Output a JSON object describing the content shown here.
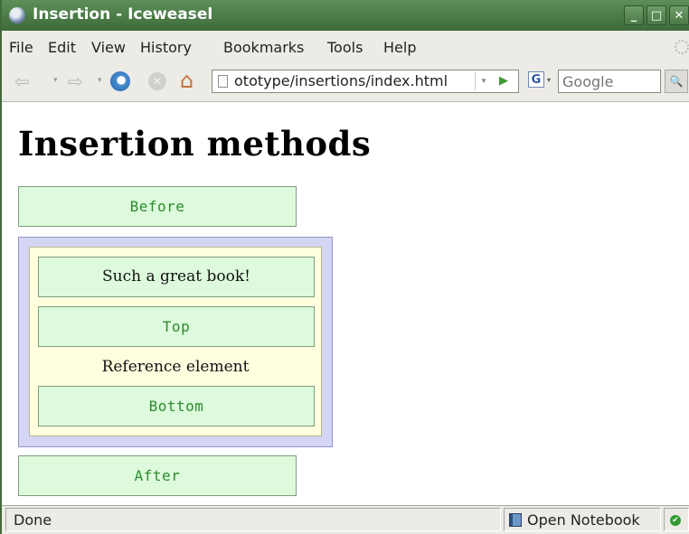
{
  "window": {
    "title": "Insertion - Iceweasel",
    "controls": {
      "minimize": "_",
      "maximize": "□",
      "close": "✕"
    }
  },
  "menu": {
    "items": [
      {
        "label": "File"
      },
      {
        "label": "Edit"
      },
      {
        "label": "View"
      },
      {
        "label": "History"
      },
      {
        "label": "Bookmarks"
      },
      {
        "label": "Tools"
      },
      {
        "label": "Help"
      }
    ]
  },
  "navigation": {
    "back_icon": "⇦",
    "forward_icon": "⇨",
    "dropdown_icon": "▾",
    "stop_icon": "✕",
    "home_icon": "⌂",
    "url": "ototype/insertions/index.html",
    "go_icon": "▶",
    "search_engine_letter": "G",
    "search_placeholder": "Google",
    "search_icon": "🔍"
  },
  "page": {
    "heading": "Insertion methods",
    "before_label": "Before",
    "book_text": "Such a great book!",
    "top_label": "Top",
    "reference_text": "Reference element",
    "bottom_label": "Bottom",
    "after_label": "After"
  },
  "status": {
    "text": "Done",
    "notebook_label": "Open Notebook",
    "ok_icon": "✔"
  },
  "colors": {
    "titlebar": "#4a7a46",
    "green_box": "#ddfadd",
    "green_text": "#2e8a2e",
    "blue_box": "#d4d4f4",
    "yellow_box": "#ffffdf"
  }
}
